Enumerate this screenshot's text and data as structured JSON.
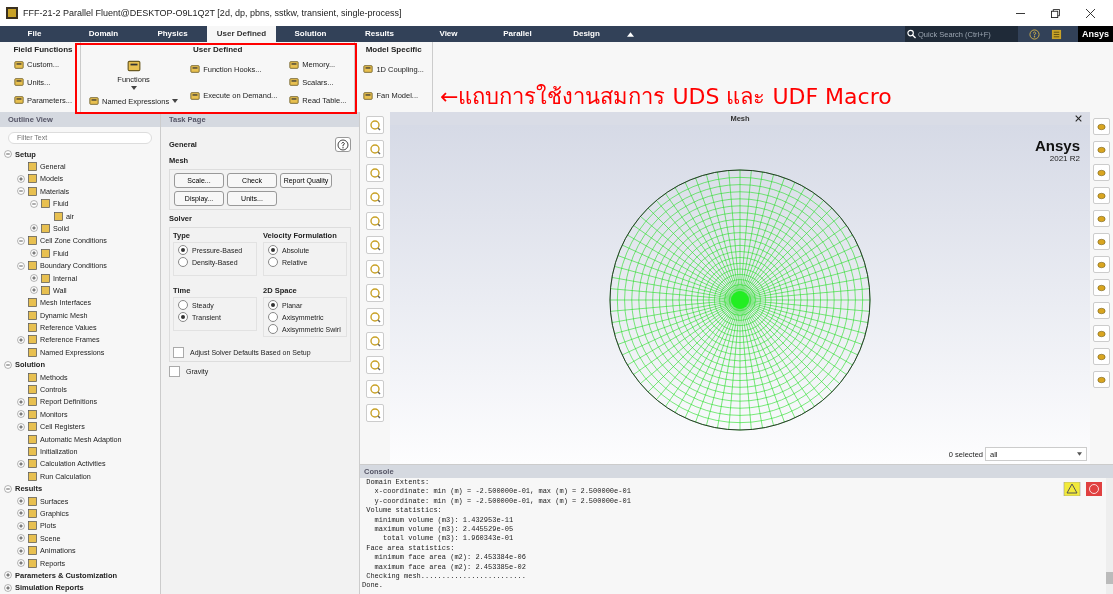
{
  "window": {
    "title": "FFF-21-2 Parallel Fluent@DESKTOP-O9L1Q2T  [2d, dp, pbns, sstkw, transient, single-process]"
  },
  "menu": [
    {
      "label": "File",
      "selected": false
    },
    {
      "label": "Domain",
      "selected": false
    },
    {
      "label": "Physics",
      "selected": false
    },
    {
      "label": "User Defined",
      "selected": true
    },
    {
      "label": "Solution",
      "selected": false
    },
    {
      "label": "Results",
      "selected": false
    },
    {
      "label": "View",
      "selected": false
    },
    {
      "label": "Parallel",
      "selected": false
    },
    {
      "label": "Design",
      "selected": false
    }
  ],
  "search": {
    "placeholder": "Quick Search (Ctrl+F)"
  },
  "brand": "Ansys",
  "ribbon": [
    {
      "title": "Field Functions",
      "columns": [
        [
          {
            "label": "Custom...",
            "kind": "small",
            "dropdown": false
          },
          {
            "label": "Units...",
            "kind": "small",
            "dropdown": false
          },
          {
            "label": "Parameters...",
            "kind": "small",
            "dropdown": false
          }
        ]
      ]
    },
    {
      "title": "User Defined",
      "columns": [
        [
          {
            "label": "Functions",
            "kind": "large",
            "dropdown": true
          },
          {
            "label": "Named Expressions",
            "kind": "small",
            "dropdown": true
          }
        ],
        [
          {
            "label": "Function Hooks...",
            "kind": "small",
            "dropdown": false
          },
          {
            "label": "Execute on Demand...",
            "kind": "small",
            "dropdown": false
          }
        ],
        [
          {
            "label": "Memory...",
            "kind": "small",
            "dropdown": false
          },
          {
            "label": "Scalars...",
            "kind": "small",
            "dropdown": false
          },
          {
            "label": "Read Table...",
            "kind": "small",
            "dropdown": false
          }
        ]
      ]
    },
    {
      "title": "Model Specific",
      "columns": [
        [
          {
            "label": "1D Coupling...",
            "kind": "small",
            "dropdown": false
          },
          {
            "label": "Fan Model...",
            "kind": "small",
            "dropdown": false
          }
        ]
      ]
    }
  ],
  "annotation": {
    "text": "←แถบการใช้งานสมการ UDS และ UDF Macro"
  },
  "outline": {
    "title": "Outline View",
    "filter_placeholder": "Filter Text",
    "tree": [
      {
        "label": "Setup",
        "expanded": true,
        "children": [
          {
            "label": "General"
          },
          {
            "label": "Models",
            "expanded": false
          },
          {
            "label": "Materials",
            "expanded": true,
            "children": [
              {
                "label": "Fluid",
                "expanded": true,
                "children": [
                  {
                    "label": "air"
                  }
                ]
              },
              {
                "label": "Solid",
                "expanded": false
              }
            ]
          },
          {
            "label": "Cell Zone Conditions",
            "expanded": true,
            "children": [
              {
                "label": "Fluid",
                "expanded": false
              }
            ]
          },
          {
            "label": "Boundary Conditions",
            "expanded": true,
            "children": [
              {
                "label": "Internal",
                "expanded": false
              },
              {
                "label": "Wall",
                "expanded": false
              }
            ]
          },
          {
            "label": "Mesh Interfaces"
          },
          {
            "label": "Dynamic Mesh"
          },
          {
            "label": "Reference Values"
          },
          {
            "label": "Reference Frames",
            "expanded": false
          },
          {
            "label": "Named Expressions"
          }
        ]
      },
      {
        "label": "Solution",
        "expanded": true,
        "children": [
          {
            "label": "Methods"
          },
          {
            "label": "Controls"
          },
          {
            "label": "Report Definitions",
            "expanded": false
          },
          {
            "label": "Monitors",
            "expanded": false
          },
          {
            "label": "Cell Registers",
            "expanded": false
          },
          {
            "label": "Automatic Mesh Adaption"
          },
          {
            "label": "Initialization"
          },
          {
            "label": "Calculation Activities",
            "expanded": false
          },
          {
            "label": "Run Calculation"
          }
        ]
      },
      {
        "label": "Results",
        "expanded": true,
        "children": [
          {
            "label": "Surfaces",
            "expanded": false
          },
          {
            "label": "Graphics",
            "expanded": false
          },
          {
            "label": "Plots",
            "expanded": false
          },
          {
            "label": "Scene",
            "expanded": false
          },
          {
            "label": "Animations",
            "expanded": false
          },
          {
            "label": "Reports",
            "expanded": false
          }
        ]
      },
      {
        "label": "Parameters & Customization",
        "expanded": false
      },
      {
        "label": "Simulation Reports",
        "expanded": false
      }
    ]
  },
  "task_page": {
    "title": "Task Page",
    "heading": "General",
    "mesh": {
      "title": "Mesh",
      "buttons": [
        "Scale...",
        "Check",
        "Report Quality",
        "Display...",
        "Units..."
      ]
    },
    "solver": {
      "title": "Solver",
      "groups": [
        {
          "title": "Type",
          "options": [
            {
              "label": "Pressure-Based",
              "selected": true
            },
            {
              "label": "Density-Based",
              "selected": false
            }
          ]
        },
        {
          "title": "Velocity Formulation",
          "options": [
            {
              "label": "Absolute",
              "selected": true
            },
            {
              "label": "Relative",
              "selected": false
            }
          ]
        },
        {
          "title": "Time",
          "options": [
            {
              "label": "Steady",
              "selected": false
            },
            {
              "label": "Transient",
              "selected": true
            }
          ]
        },
        {
          "title": "2D Space",
          "options": [
            {
              "label": "Planar",
              "selected": true
            },
            {
              "label": "Axisymmetric",
              "selected": false
            },
            {
              "label": "Axisymmetric Swirl",
              "selected": false
            }
          ]
        }
      ],
      "checkbox": {
        "label": "Adjust Solver Defaults Based on Setup",
        "checked": false
      }
    },
    "gravity": {
      "label": "Gravity",
      "checked": false
    }
  },
  "graphics": {
    "title": "Mesh",
    "brand": "Ansys",
    "version": "2021 R2",
    "selection_count": "0 selected",
    "selection_filter": "all"
  },
  "console": {
    "title": "Console",
    "lines": [
      " Domain Extents:",
      "   x-coordinate: min (m) = -2.500000e-01, max (m) = 2.500000e-01",
      "   y-coordinate: min (m) = -2.500000e-01, max (m) = 2.500000e-01",
      " Volume statistics:",
      "   minimum volume (m3): 1.432953e-11",
      "   maximum volume (m3): 2.445529e-05",
      "     total volume (m3): 1.960343e-01",
      " Face area statistics:",
      "   minimum face area (m2): 2.453384e-06",
      "   maximum face area (m2): 2.453385e-02",
      " Checking mesh.........................",
      "Done."
    ]
  }
}
